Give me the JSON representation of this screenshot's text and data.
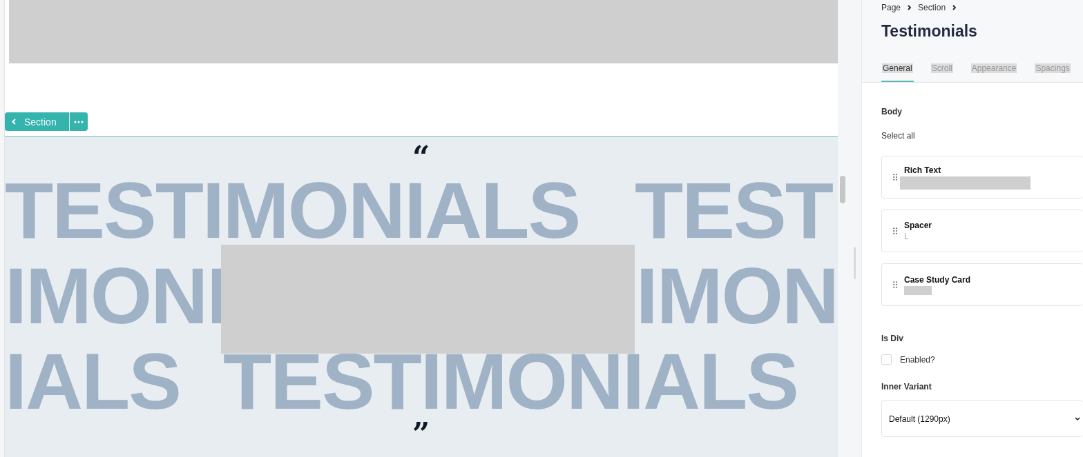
{
  "canvas": {
    "section_toolbar": {
      "label": "Section"
    },
    "background_words": [
      [
        "TESTIMONIALS",
        "TEST"
      ],
      [
        "IMONI",
        "IMON"
      ],
      [
        "IALS",
        "TESTIMONIALS"
      ]
    ],
    "quotes": {
      "open": "“",
      "close": "”"
    }
  },
  "panel": {
    "breadcrumb": [
      "Page",
      "Section"
    ],
    "title": "Testimonials",
    "tabs": [
      {
        "label": "General",
        "selected": true
      },
      {
        "label": "Scroll",
        "selected": false
      },
      {
        "label": "Appearance",
        "selected": false
      },
      {
        "label": "Spacings",
        "selected": false
      }
    ],
    "body": {
      "label": "Body",
      "select_all": "Select all",
      "items": [
        {
          "title": "Rich Text",
          "kind": "redacted-wide"
        },
        {
          "title": "Spacer",
          "kind": "text",
          "subtitle": "L"
        },
        {
          "title": "Case Study Card",
          "kind": "redacted-short"
        }
      ]
    },
    "is_div": {
      "label": "Is Div",
      "checkbox_label": "Enabled?",
      "checked": false
    },
    "inner_variant": {
      "label": "Inner Variant",
      "value": "Default (1290px)"
    }
  }
}
